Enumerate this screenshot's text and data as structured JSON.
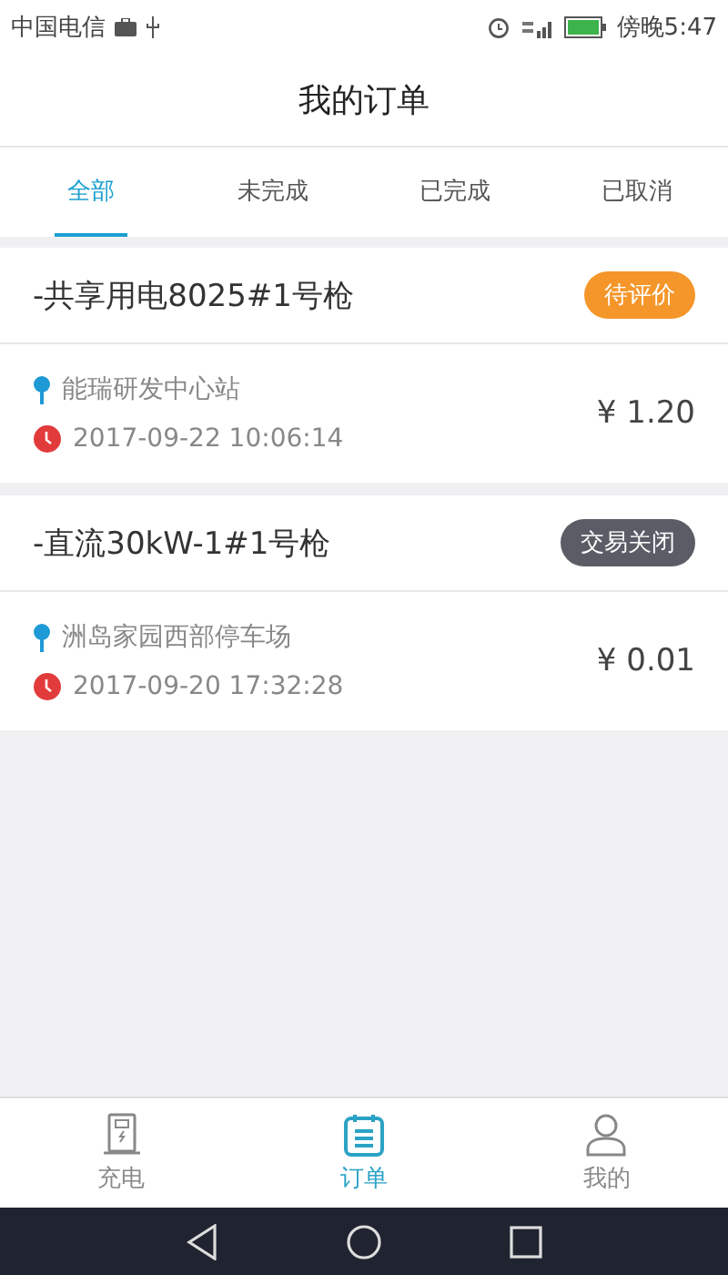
{
  "status_bar": {
    "carrier": "中国电信",
    "time": "傍晚5:47"
  },
  "header": {
    "title": "我的订单"
  },
  "tabs": [
    {
      "label": "全部",
      "selected": true
    },
    {
      "label": "未完成",
      "selected": false
    },
    {
      "label": "已完成",
      "selected": false
    },
    {
      "label": "已取消",
      "selected": false
    }
  ],
  "orders": [
    {
      "name": "-共享用电8025#1号枪",
      "status": "待评价",
      "kind": "pending",
      "station": "能瑞研发中心站",
      "time": "2017-09-22 10:06:14",
      "amount": "¥ 1.20"
    },
    {
      "name": "-直流30kW-1#1号枪",
      "status": "交易关闭",
      "kind": "closed",
      "station": "洲岛家园西部停车场",
      "time": "2017-09-20 17:32:28",
      "amount": "¥ 0.01"
    }
  ],
  "bottom_nav": [
    {
      "label": "充电",
      "kind": "charge",
      "selected": false
    },
    {
      "label": "订单",
      "kind": "orders",
      "selected": true
    },
    {
      "label": "我的",
      "kind": "profile",
      "selected": false
    }
  ]
}
